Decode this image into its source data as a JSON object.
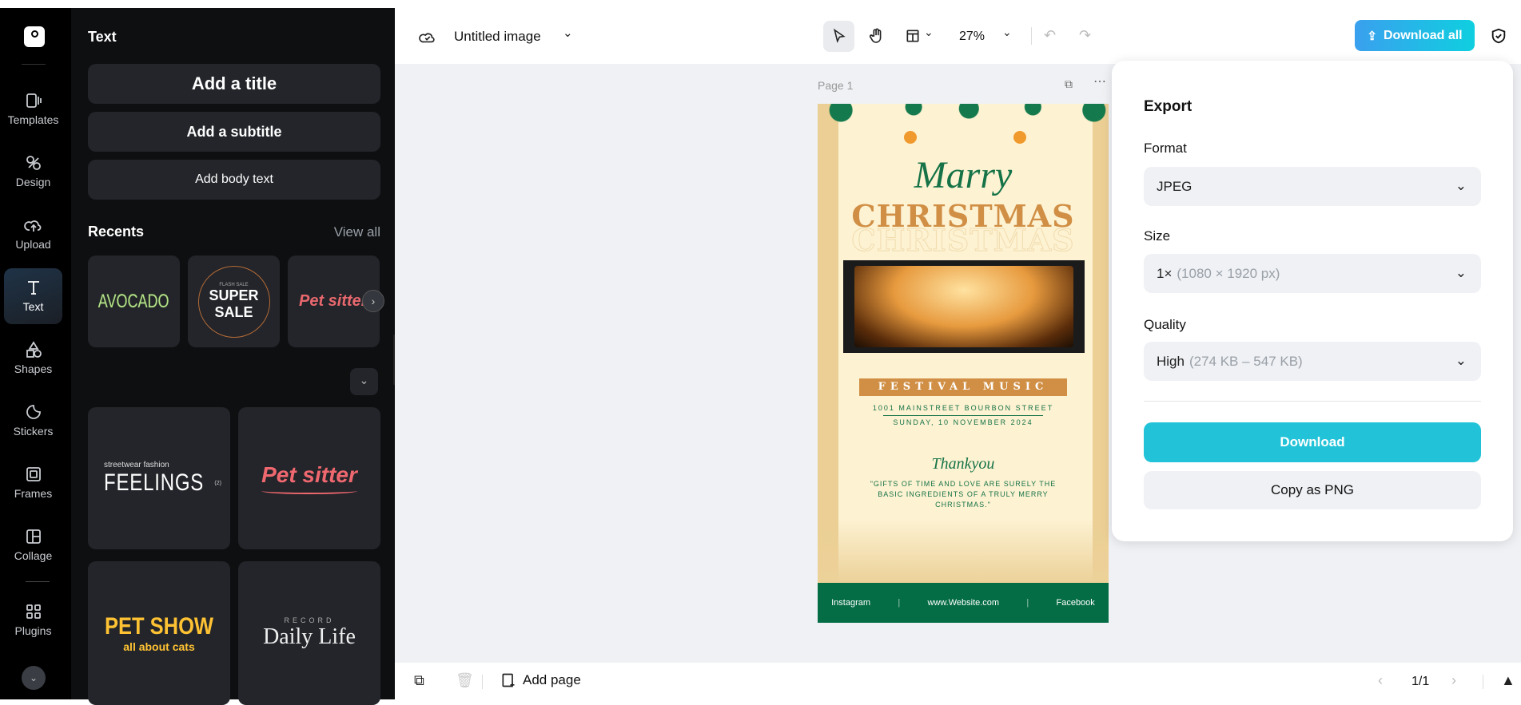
{
  "rail": {
    "items": [
      {
        "label": "Templates",
        "icon": "templates-icon"
      },
      {
        "label": "Design",
        "icon": "design-icon"
      },
      {
        "label": "Upload",
        "icon": "upload-icon"
      },
      {
        "label": "Text",
        "icon": "text-icon"
      },
      {
        "label": "Shapes",
        "icon": "shapes-icon"
      },
      {
        "label": "Stickers",
        "icon": "stickers-icon"
      },
      {
        "label": "Frames",
        "icon": "frames-icon"
      },
      {
        "label": "Collage",
        "icon": "collage-icon"
      },
      {
        "label": "Plugins",
        "icon": "plugins-icon"
      }
    ]
  },
  "panel": {
    "title": "Text",
    "add_title": "Add a title",
    "add_subtitle": "Add a subtitle",
    "add_body": "Add body text",
    "recents_label": "Recents",
    "view_all": "View all",
    "recents": [
      {
        "text": "AVOCADO"
      },
      {
        "small": "FLASH SALE",
        "line1": "SUPER",
        "line2": "SALE"
      },
      {
        "text": "Pet sitter"
      }
    ],
    "templates": [
      {
        "small": "streetwear fashion",
        "main": "FEELINGS",
        "sup": "(2)"
      },
      {
        "main": "Pet sitter"
      },
      {
        "main": "PET SHOW",
        "sub": "all about cats"
      },
      {
        "small": "RECORD",
        "main": "Daily Life"
      }
    ]
  },
  "toolbar": {
    "doc_title": "Untitled image",
    "zoom": "27%",
    "download_all": "Download all"
  },
  "canvas": {
    "page_label": "Page 1"
  },
  "poster": {
    "script_title": "Marry",
    "title": "CHRISTMAS",
    "banner": "FESTIVAL MUSIC",
    "address": "1001 MAINSTREET BOURBON STREET",
    "date": "SUNDAY, 10 NOVEMBER 2024",
    "thanks": "Thankyou",
    "quote": "\"GIFTS OF TIME AND LOVE ARE SURELY THE BASIC INGREDIENTS OF A TRULY MERRY CHRISTMAS.\"",
    "footer": [
      "Instagram",
      "www.Website.com",
      "Facebook"
    ]
  },
  "export": {
    "title": "Export",
    "format_label": "Format",
    "format_value": "JPEG",
    "size_label": "Size",
    "size_value": "1×",
    "size_detail": "(1080 × 1920 px)",
    "quality_label": "Quality",
    "quality_value": "High",
    "quality_detail": "(274 KB – 547 KB)",
    "download": "Download",
    "copy_png": "Copy as PNG"
  },
  "bottom": {
    "add_page": "Add page",
    "page_indicator": "1/1"
  },
  "colors": {
    "accent": "#22c3d8",
    "poster_green": "#046d45",
    "poster_gold": "#d08f45"
  }
}
